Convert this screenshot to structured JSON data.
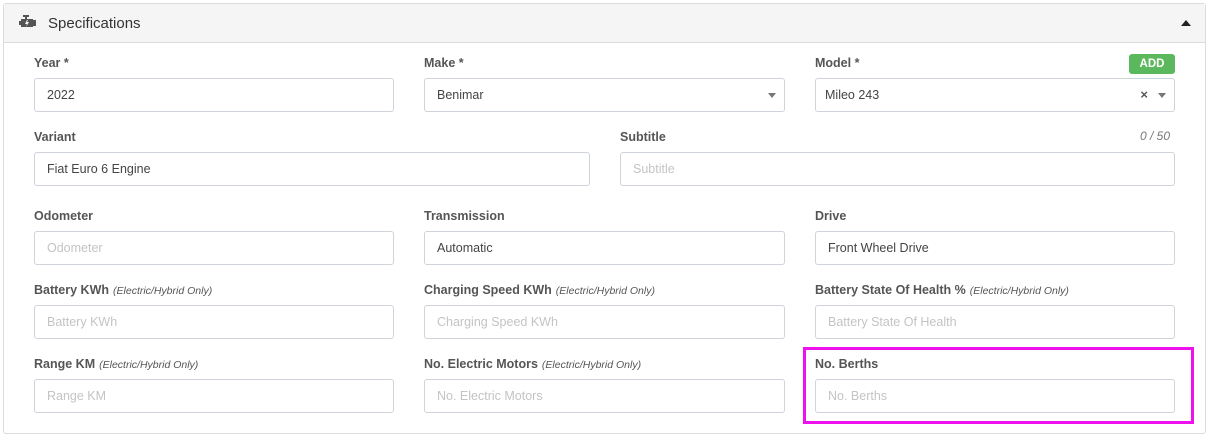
{
  "panel": {
    "title": "Specifications",
    "icon": "engine-icon",
    "collapse_icon": "caret-up-icon"
  },
  "fields": {
    "year": {
      "label": "Year *",
      "value": "2022"
    },
    "make": {
      "label": "Make *",
      "value": "Benimar"
    },
    "model": {
      "label": "Model *",
      "value": "Mileo 243",
      "add_label": "ADD",
      "clear_glyph": "×"
    },
    "variant": {
      "label": "Variant",
      "value": "Fiat Euro 6 Engine"
    },
    "subtitle": {
      "label": "Subtitle",
      "placeholder": "Subtitle",
      "counter": "0 / 50"
    },
    "odometer": {
      "label": "Odometer",
      "placeholder": "Odometer"
    },
    "transmission": {
      "label": "Transmission",
      "value": "Automatic"
    },
    "drive": {
      "label": "Drive",
      "value": "Front Wheel Drive"
    },
    "battery_kwh": {
      "label": "Battery KWh",
      "hint": "(Electric/Hybrid Only)",
      "placeholder": "Battery KWh"
    },
    "charging_speed": {
      "label": "Charging Speed KWh",
      "hint": "(Electric/Hybrid Only)",
      "placeholder": "Charging Speed KWh"
    },
    "battery_health": {
      "label": "Battery State Of Health %",
      "hint": "(Electric/Hybrid Only)",
      "placeholder": "Battery State Of Health"
    },
    "range_km": {
      "label": "Range KM",
      "hint": "(Electric/Hybrid Only)",
      "placeholder": "Range KM"
    },
    "electric_motors": {
      "label": "No. Electric Motors",
      "hint": "(Electric/Hybrid Only)",
      "placeholder": "No. Electric Motors"
    },
    "berths": {
      "label": "No. Berths",
      "placeholder": "No. Berths"
    }
  },
  "colors": {
    "add_button": "#5cb85c",
    "highlight": "#ee11ee"
  }
}
